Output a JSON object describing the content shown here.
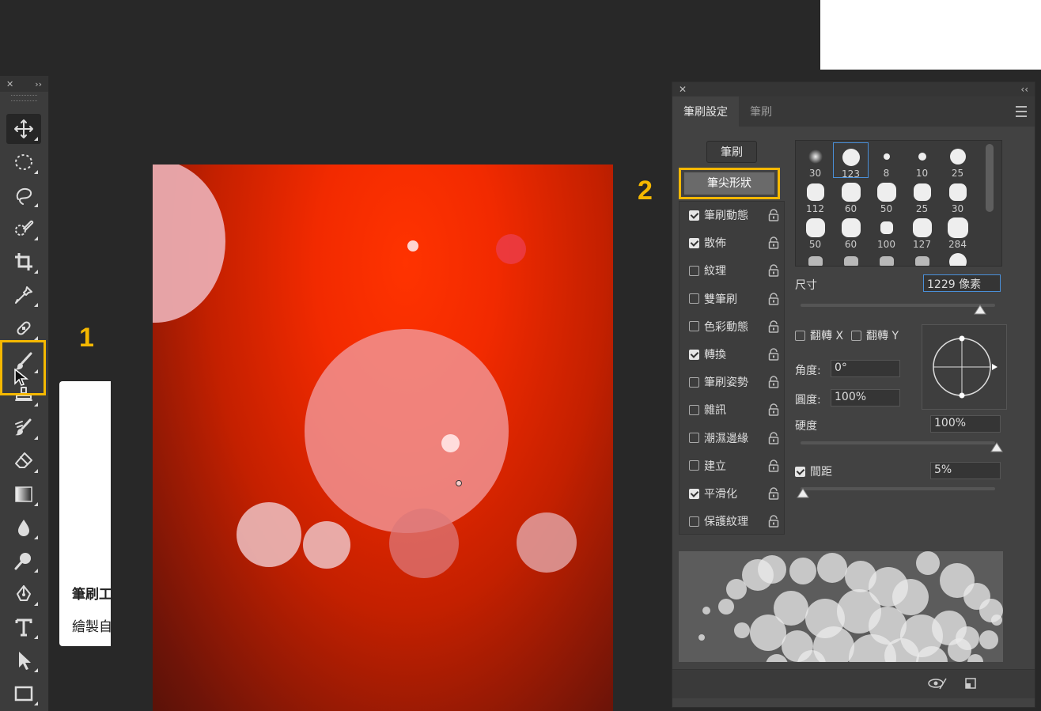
{
  "toolbar": {
    "close_glyph": "✕",
    "collapse_glyph": "››",
    "tools": [
      {
        "name": "move-icon"
      },
      {
        "name": "elliptical-marquee-icon"
      },
      {
        "name": "lasso-icon"
      },
      {
        "name": "quick-selection-icon"
      },
      {
        "name": "crop-icon"
      },
      {
        "name": "eyedropper-icon"
      },
      {
        "name": "healing-brush-icon"
      },
      {
        "name": "brush-icon"
      },
      {
        "name": "clone-stamp-icon"
      },
      {
        "name": "history-brush-icon"
      },
      {
        "name": "eraser-icon"
      },
      {
        "name": "gradient-icon"
      },
      {
        "name": "blur-icon"
      },
      {
        "name": "dodge-icon"
      },
      {
        "name": "pen-icon"
      },
      {
        "name": "type-icon"
      },
      {
        "name": "path-selection-icon"
      },
      {
        "name": "rectangle-icon"
      }
    ],
    "active_tool": "brush-icon"
  },
  "annotations": {
    "step1": "1",
    "step2": "2",
    "highlight_color": "#f5b800"
  },
  "tooltip": {
    "title": "筆刷工",
    "desc": "繪製自"
  },
  "panel": {
    "close_glyph": "✕",
    "collapse_glyph": "‹‹",
    "tabs": [
      {
        "label": "筆刷設定",
        "active": true
      },
      {
        "label": "筆刷",
        "active": false
      }
    ],
    "brush_button": "筆刷",
    "tip_shape_button": "筆尖形狀",
    "options": [
      {
        "label": "筆刷動態",
        "checked": true
      },
      {
        "label": "散佈",
        "checked": true
      },
      {
        "label": "紋理",
        "checked": false
      },
      {
        "label": "雙筆刷",
        "checked": false
      },
      {
        "label": "色彩動態",
        "checked": false
      },
      {
        "label": "轉換",
        "checked": true
      },
      {
        "label": "筆刷姿勢",
        "checked": false
      },
      {
        "label": "雜訊",
        "checked": false
      },
      {
        "label": "潮濕邊緣",
        "checked": false
      },
      {
        "label": "建立",
        "checked": false
      },
      {
        "label": "平滑化",
        "checked": true
      },
      {
        "label": "保護紋理",
        "checked": false
      }
    ],
    "presets": [
      "30",
      "123",
      "8",
      "10",
      "25",
      "112",
      "60",
      "50",
      "25",
      "30",
      "50",
      "60",
      "100",
      "127",
      "284"
    ],
    "selected_preset": "123",
    "size_label": "尺寸",
    "size_value": "1229 像素",
    "flip_x": "翻轉 X",
    "flip_y": "翻轉 Y",
    "angle_label": "角度:",
    "angle_value": "0°",
    "roundness_label": "圓度:",
    "roundness_value": "100%",
    "hardness_label": "硬度",
    "hardness_value": "100%",
    "spacing_label": "間距",
    "spacing_checked": true,
    "spacing_value": "5%"
  }
}
